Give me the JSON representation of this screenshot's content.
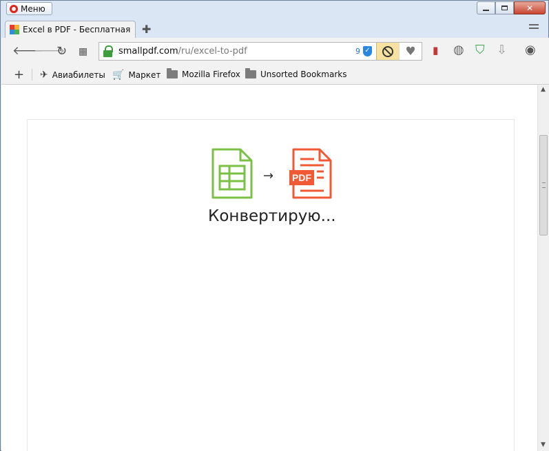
{
  "window": {
    "menu_label": "Меню"
  },
  "tab": {
    "title": "Excel в PDF - Бесплатная"
  },
  "address_bar": {
    "url_host": "smallpdf.com",
    "url_path": "/ru/excel-to-pdf",
    "badge_count": "9"
  },
  "bookmarks": [
    {
      "label": "Авиабилеты",
      "icon": "plane-icon"
    },
    {
      "label": "Маркет",
      "icon": "cart-icon"
    },
    {
      "label": "Mozilla Firefox",
      "icon": "folder-icon"
    },
    {
      "label": "Unsorted Bookmarks",
      "icon": "folder-icon"
    }
  ],
  "main": {
    "status_text": "Конвертирую...",
    "pdf_label": "PDF"
  },
  "colors": {
    "excel_green": "#7ac143",
    "pdf_red": "#ef5a34",
    "lock_green": "#3a9e3a"
  }
}
